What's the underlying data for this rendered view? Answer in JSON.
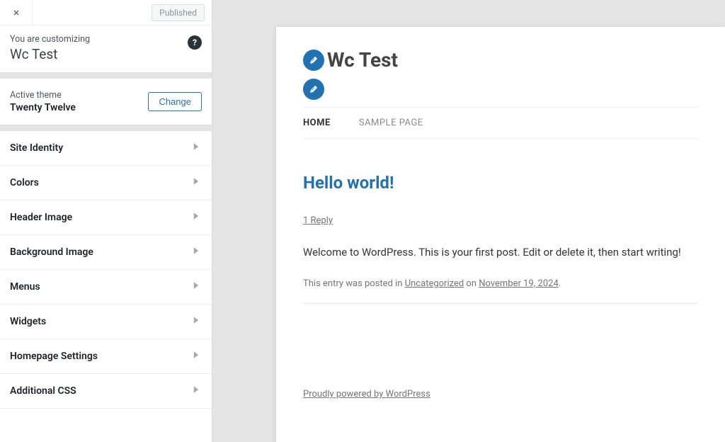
{
  "sidebar": {
    "published_label": "Published",
    "customizing_label": "You are customizing",
    "customizing_title": "Wc Test",
    "theme_label": "Active theme",
    "theme_name": "Twenty Twelve",
    "change_label": "Change",
    "items": [
      {
        "label": "Site Identity"
      },
      {
        "label": "Colors"
      },
      {
        "label": "Header Image"
      },
      {
        "label": "Background Image"
      },
      {
        "label": "Menus"
      },
      {
        "label": "Widgets"
      },
      {
        "label": "Homepage Settings"
      },
      {
        "label": "Additional CSS"
      }
    ]
  },
  "preview": {
    "site_title": "Wc Test",
    "nav": [
      {
        "label": "HOME",
        "active": true
      },
      {
        "label": "SAMPLE PAGE",
        "active": false
      }
    ],
    "post": {
      "title": "Hello world!",
      "reply": "1 Reply",
      "body": "Welcome to WordPress. This is your first post. Edit or delete it, then start writing!",
      "meta_prefix": "This entry was posted in ",
      "category": "Uncategorized",
      "meta_on": " on ",
      "date": "November 19, 2024",
      "meta_suffix": "."
    },
    "footer": "Proudly powered by WordPress"
  }
}
